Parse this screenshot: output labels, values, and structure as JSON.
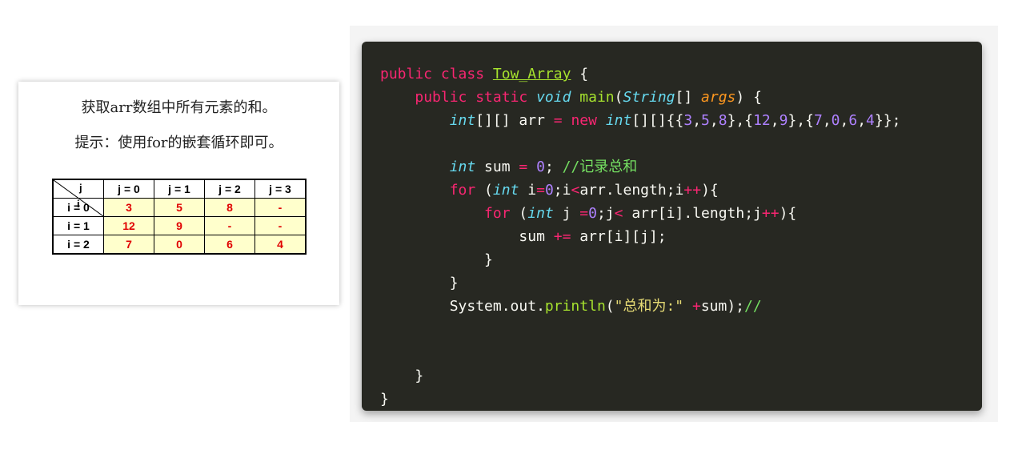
{
  "prompt": {
    "line1": "获取arr数组中所有元素的和。",
    "line2": "提示：使用for的嵌套循环即可。"
  },
  "table": {
    "corner_j": "j",
    "corner_i": "i",
    "columns": [
      "j = 0",
      "j = 1",
      "j = 2",
      "j = 3"
    ],
    "rows": [
      {
        "label": "i = 0",
        "cells": [
          "3",
          "5",
          "8",
          "-"
        ]
      },
      {
        "label": "i = 1",
        "cells": [
          "12",
          "9",
          "-",
          "-"
        ]
      },
      {
        "label": "i = 2",
        "cells": [
          "7",
          "0",
          "6",
          "4"
        ]
      }
    ]
  },
  "code": {
    "l1": {
      "kw": "public class",
      "cls": "Tow_Array",
      "end": " {"
    },
    "l2": {
      "kw": "public static",
      "ty": "void",
      "fn": "main",
      "p1": "(",
      "ty2": "String",
      "p2": "[] ",
      "arg": "args",
      "end": ") {"
    },
    "l3": {
      "ty": "int",
      "a": "[][] arr ",
      "eq": "=",
      "kw": "new",
      "ty2": "int",
      "b": "[][]{{",
      "n1": "3",
      "n2": "5",
      "n3": "8",
      "n4": "12",
      "n5": "9",
      "n6": "7",
      "n7": "0",
      "n8": "6",
      "n9": "4",
      "end": "}};"
    },
    "l5": {
      "ty": "int",
      "a": " sum ",
      "eq": "=",
      "n": "0",
      "b": "; ",
      "cm": "//记录总和"
    },
    "l6": {
      "kw": "for",
      "a": " (",
      "ty": "int",
      "b": " i",
      "eq": "=",
      "n": "0",
      "c": ";i",
      "lt": "<",
      "d": "arr.length;i",
      "pp": "++",
      "end": "){"
    },
    "l7": {
      "kw": "for",
      "a": " (",
      "ty": "int",
      "b": " j ",
      "eq": "=",
      "n": "0",
      "c": ";j",
      "lt": "<",
      "d": " arr[i].length;j",
      "pp": "++",
      "end": "){"
    },
    "l8": {
      "a": "sum ",
      "op": "+=",
      "b": " arr[i][j];"
    },
    "l9": "}",
    "l10": "}",
    "l11": {
      "a": "System.out.",
      "fn": "println",
      "b": "(",
      "str": "\"总和为:\"",
      "c": " ",
      "op": "+",
      "d": "sum);",
      "cm": "//"
    },
    "l14": "}",
    "l15": "}"
  }
}
